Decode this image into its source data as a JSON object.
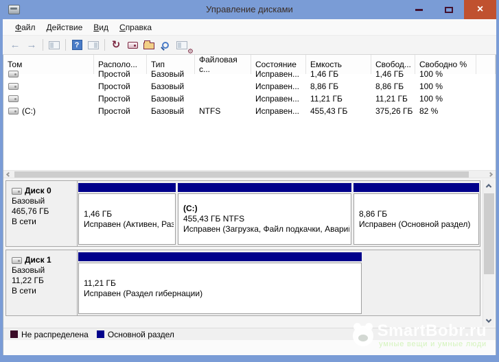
{
  "window": {
    "title": "Управление дисками",
    "icons": {
      "close": "×"
    }
  },
  "menu": {
    "items": [
      "Файл",
      "Действие",
      "Вид",
      "Справка"
    ]
  },
  "toolbar": {
    "icons": [
      {
        "name": "back",
        "glyph": "←"
      },
      {
        "name": "forward",
        "glyph": "→"
      },
      {
        "name": "show-console-tree",
        "glyph": ""
      },
      {
        "name": "help",
        "glyph": "?"
      },
      {
        "name": "show-action-pane",
        "glyph": ""
      },
      {
        "name": "refresh",
        "glyph": "↻"
      },
      {
        "name": "rescan-disks",
        "glyph": ""
      },
      {
        "name": "open",
        "glyph": ""
      },
      {
        "name": "find",
        "glyph": ""
      },
      {
        "name": "properties",
        "glyph": "⚙"
      }
    ]
  },
  "volume_table": {
    "columns": [
      "Том",
      "Располо...",
      "Тип",
      "Файловая с...",
      "Состояние",
      "Емкость",
      "Свобод...",
      "Свободно %"
    ],
    "rows": [
      {
        "volume": "",
        "layout": "Простой",
        "type": "Базовый",
        "fs": "",
        "status": "Исправен...",
        "capacity": "1,46 ГБ",
        "free": "1,46 ГБ",
        "free_pct": "100 %"
      },
      {
        "volume": "",
        "layout": "Простой",
        "type": "Базовый",
        "fs": "",
        "status": "Исправен...",
        "capacity": "8,86 ГБ",
        "free": "8,86 ГБ",
        "free_pct": "100 %"
      },
      {
        "volume": "",
        "layout": "Простой",
        "type": "Базовый",
        "fs": "",
        "status": "Исправен...",
        "capacity": "11,21 ГБ",
        "free": "11,21 ГБ",
        "free_pct": "100 %"
      },
      {
        "volume": "(C:)",
        "layout": "Простой",
        "type": "Базовый",
        "fs": "NTFS",
        "status": "Исправен...",
        "capacity": "455,43 ГБ",
        "free": "375,26 ГБ",
        "free_pct": "82 %"
      }
    ]
  },
  "disks": [
    {
      "name": "Диск 0",
      "type": "Базовый",
      "size": "465,76 ГБ",
      "status": "В сети",
      "partitions": [
        {
          "title": "",
          "size_line": "1,46 ГБ",
          "status_line": "Исправен (Активен, Раз"
        },
        {
          "title": "(C:)",
          "size_line": "455,43 ГБ NTFS",
          "status_line": "Исправен (Загрузка, Файл подкачки, Аварий"
        },
        {
          "title": "",
          "size_line": "8,86 ГБ",
          "status_line": "Исправен (Основной раздел)"
        }
      ]
    },
    {
      "name": "Диск 1",
      "type": "Базовый",
      "size": "11,22 ГБ",
      "status": "В сети",
      "partitions": [
        {
          "title": "",
          "size_line": "11,21 ГБ",
          "status_line": "Исправен (Раздел гибернации)"
        }
      ]
    }
  ],
  "legend": {
    "items": [
      {
        "label": "Не распределена",
        "color": "#3a0b27"
      },
      {
        "label": "Основной раздел",
        "color": "#00008b"
      }
    ]
  },
  "watermark": {
    "brand": "SmartBobr.ru",
    "tagline": "умные вещи и умные люди"
  },
  "colors": {
    "titlebar": "#7a9cd6",
    "close_button": "#c0512f",
    "partition_primary": "#00008b"
  }
}
